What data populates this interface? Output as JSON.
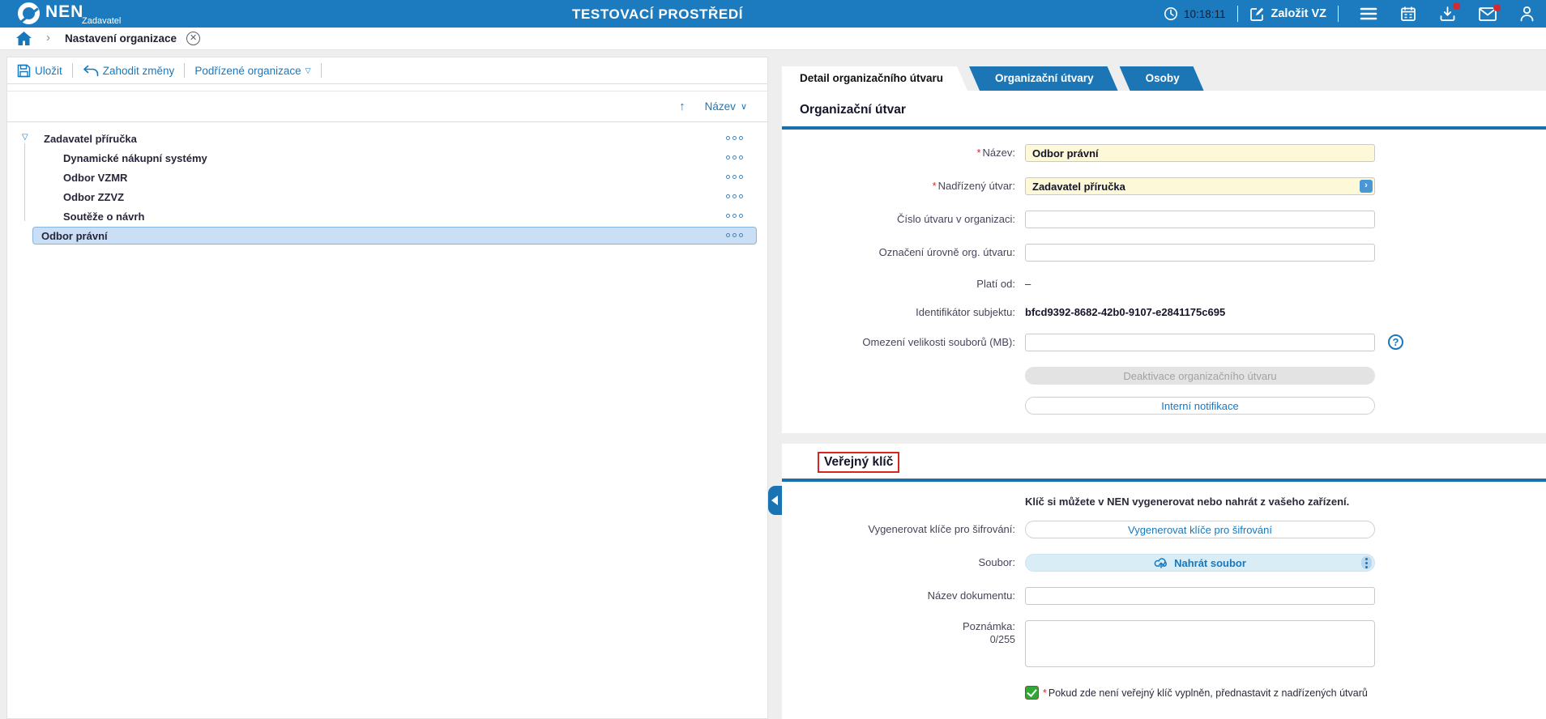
{
  "header": {
    "brand": "NEN",
    "brand_sub": "Zadavatel",
    "environment_title": "TESTOVACÍ PROSTŘEDÍ",
    "time": "10:18:11",
    "create_button": "Založit VZ"
  },
  "breadcrumb": {
    "page_title": "Nastavení organizace"
  },
  "toolbar": {
    "save": "Uložit",
    "discard": "Zahodit změny",
    "suborgs": "Podřízené organizace"
  },
  "tree": {
    "sort_column": "Název",
    "items": [
      {
        "label": "Zadavatel příručka"
      },
      {
        "label": "Dynamické nákupní systémy"
      },
      {
        "label": "Odbor VZMR"
      },
      {
        "label": "Odbor ZZVZ"
      },
      {
        "label": "Soutěže o návrh"
      },
      {
        "label": "Odbor právní"
      }
    ]
  },
  "tabs": [
    {
      "label": "Detail organizačního útvaru"
    },
    {
      "label": "Organizační útvary"
    },
    {
      "label": "Osoby"
    }
  ],
  "detail": {
    "section_title": "Organizační útvar",
    "fields": {
      "nazev": {
        "label": "Název:",
        "value": "Odbor právní"
      },
      "nadrizeny": {
        "label": "Nadřízený útvar:",
        "value": "Zadavatel příručka"
      },
      "cislo": {
        "label": "Číslo útvaru v organizaci:",
        "value": ""
      },
      "oznaceni": {
        "label": "Označení úrovně org. útvaru:",
        "value": ""
      },
      "plati_od": {
        "label": "Platí od:",
        "value": "–"
      },
      "identifikator": {
        "label": "Identifikátor subjektu:",
        "value": "bfcd9392-8682-42b0-9107-e2841175c695"
      },
      "omezeni": {
        "label": "Omezení velikosti souborů (MB):",
        "value": ""
      }
    },
    "buttons": {
      "deactivate": "Deaktivace organizačního útvaru",
      "notifications": "Interní notifikace"
    }
  },
  "public_key": {
    "section_title": "Veřejný klíč",
    "info": "Klíč si můžete v NEN vygenerovat nebo nahrát z vašeho zařízení.",
    "generate": {
      "label": "Vygenerovat klíče pro šifrování:",
      "button": "Vygenerovat klíče pro šifrování"
    },
    "file": {
      "label": "Soubor:",
      "button": "Nahrát soubor"
    },
    "doc_name": {
      "label": "Název dokumentu:",
      "value": ""
    },
    "note": {
      "label": "Poznámka:",
      "counter": "0/255",
      "value": ""
    },
    "checkbox": {
      "label": "Pokud zde není veřejný klíč vyplněn, přednastavit z nadřízených útvarů",
      "checked": true
    }
  },
  "icons": {
    "expander_open": "▽",
    "dropdown_caret": "▽",
    "sort_asc": "↑",
    "sort_caret": "∨",
    "breadcrumb_chevron": "›",
    "close_x": "✕",
    "lookup_chevron": "›",
    "help": "?"
  },
  "misc": {
    "required_mark": "*"
  },
  "colors": {
    "topbar_blue": "#1c7bbe",
    "accent_blue": "#1878be",
    "tab_blue": "#1c76b6",
    "rule_blue": "#1a70ad",
    "field_yellow": "#fcf8d8",
    "selected_row": "#cadef5",
    "badge_red": "#d7282f",
    "focus_red": "#d8251f",
    "checkbox_green": "#2fa838",
    "upload_blue": "#d9edf7"
  }
}
